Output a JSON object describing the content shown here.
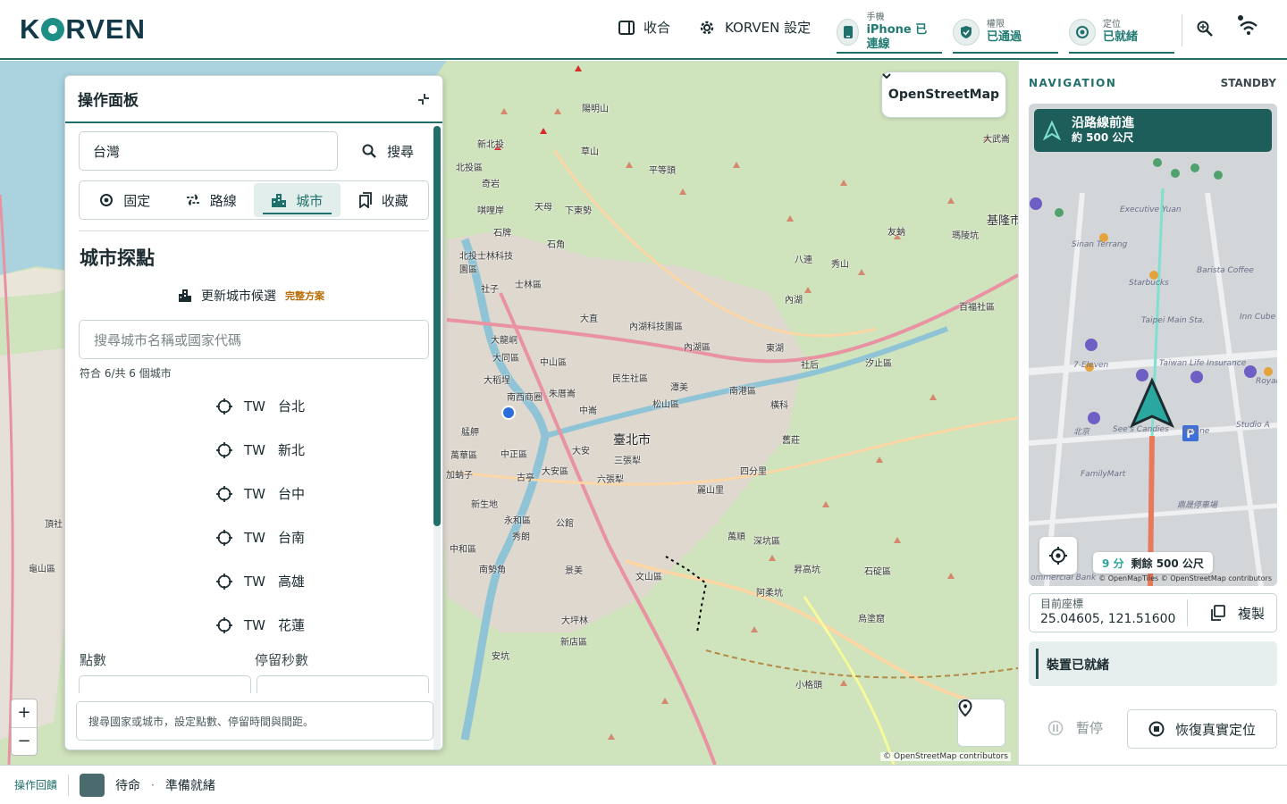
{
  "header": {
    "brand": "KORVEN",
    "collapse_label": "收合",
    "settings_label": "KORVEN 設定",
    "statuses": [
      {
        "small": "手機",
        "value": "iPhone 已連線"
      },
      {
        "small": "權限",
        "value": "已通過"
      },
      {
        "small": "定位",
        "value": "已就緒"
      }
    ]
  },
  "map": {
    "layer": "OpenStreetMap",
    "attribution": "© OpenStreetMap contributors",
    "zoom_in": "+",
    "zoom_out": "−",
    "labels": [
      "陽明山",
      "草山",
      "新北投",
      "北投區",
      "奇岩",
      "唭哩岸",
      "天母",
      "下東勢",
      "平等頭",
      "石牌",
      "石角",
      "北投士林科技園區",
      "士林區",
      "社子",
      "大直",
      "內湖科技園區",
      "內湖",
      "大龍峒",
      "大同區",
      "中山區",
      "大稻埕",
      "民生社區",
      "內湖區",
      "東湖",
      "南西商圈",
      "朱厝崙",
      "潭美",
      "松山區",
      "南港區",
      "社后",
      "汐止區",
      "艋舺",
      "中崙",
      "萬華區",
      "中正區",
      "大安",
      "大安區",
      "三張犁",
      "加蚋子",
      "古亭",
      "六張犁",
      "四分里",
      "新生地",
      "永和區",
      "秀朗",
      "公館",
      "麗山里",
      "中和區",
      "萬順",
      "深坑區",
      "南勢角",
      "景美",
      "文山區",
      "昇高坑",
      "石碇區",
      "大坪林",
      "新店區",
      "阿柔坑",
      "烏塗窟",
      "安坑",
      "小格頭",
      "頂社",
      "龜山區",
      "大武崙",
      "基隆市",
      "友蚋",
      "瑪陵坑",
      "八連",
      "秀山",
      "百福社區",
      "汐止",
      "橫科",
      "舊莊",
      "臺北市"
    ],
    "city_label": "臺北市"
  },
  "panel": {
    "title": "操作面板",
    "search_value": "台灣",
    "search_button": "搜尋",
    "tabs": [
      "固定",
      "路線",
      "城市",
      "收藏"
    ],
    "active_tab": "城市",
    "section_title": "城市探點",
    "update_label": "更新城市候選",
    "plan_badge": "完整方案",
    "city_search_placeholder": "搜尋城市名稱或國家代碼",
    "match_count": "符合 6/共 6 個城市",
    "cities": [
      {
        "code": "TW",
        "name": "台北"
      },
      {
        "code": "TW",
        "name": "新北"
      },
      {
        "code": "TW",
        "name": "台中"
      },
      {
        "code": "TW",
        "name": "台南"
      },
      {
        "code": "TW",
        "name": "高雄"
      },
      {
        "code": "TW",
        "name": "花蓮"
      }
    ],
    "points_label": "點數",
    "stay_label": "停留秒數",
    "hint": "搜尋國家或城市，設定點數、停留時間與間距。"
  },
  "navigation": {
    "title": "NAVIGATION",
    "state": "STANDBY",
    "banner_title": "沿路線前進",
    "banner_sub": "約 500 公尺",
    "eta_minutes": "9 分",
    "eta_remaining": "剩餘 500 公尺",
    "map_attribution": "© OpenMapTiles © OpenStreetMap contributors",
    "map_labels": [
      "Executive Yuan",
      "Sinan Terrang",
      "Starbucks",
      "Barista Coffee",
      "Taipei Main Sta.",
      "7-Eleven",
      "Taiwan Life Insurance",
      "See's Candies",
      "Winne",
      "Studio A",
      "FamilyMart",
      "Inn Cube",
      "Royal",
      "鼎晟停車場",
      "北京",
      "ommercial Bank"
    ],
    "coord_label": "目前座標",
    "coord_value": "25.04605, 121.51600",
    "copy_label": "複製",
    "device_status": "裝置已就緒",
    "pause_label": "暫停",
    "restore_label": "恢復真實定位"
  },
  "footer": {
    "feedback_label": "操作回饋",
    "state": "待命",
    "separator": "·",
    "ready": "準備就緒"
  },
  "colors": {
    "accent": "#1f6f6b",
    "brand_dark": "#143a4a",
    "status_value": "#1f7a72",
    "plan_badge": "#b86a00"
  }
}
